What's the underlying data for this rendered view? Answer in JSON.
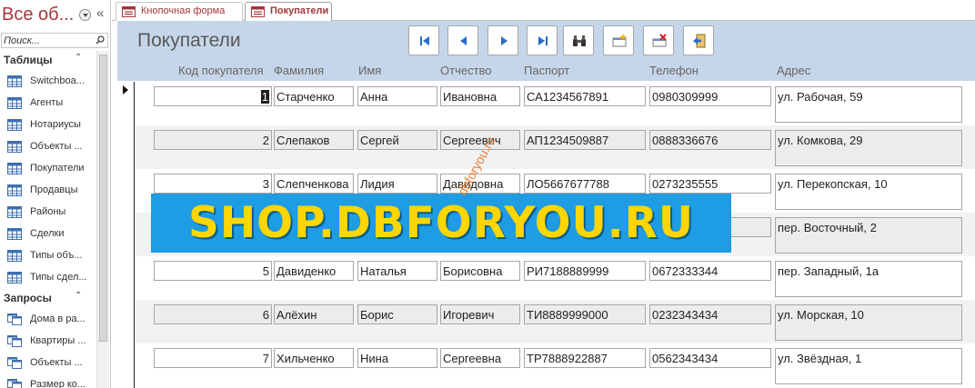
{
  "nav": {
    "title": "Все об...",
    "search_placeholder": "Поиск...",
    "groups": [
      {
        "label": "Таблицы",
        "items": [
          "Switchboa...",
          "Агенты",
          "Нотариусы",
          "Объекты ...",
          "Покупатели",
          "Продавцы",
          "Районы",
          "Сделки",
          "Типы объ...",
          "Типы сдел..."
        ]
      },
      {
        "label": "Запросы",
        "items": [
          "Дома в ра...",
          "Квартиры ...",
          "Объекты ...",
          "Размер ко..."
        ]
      }
    ]
  },
  "tabs": [
    {
      "label": "Кнопочная форма",
      "active": false
    },
    {
      "label": "Покупатели",
      "active": true
    }
  ],
  "form": {
    "title": "Покупатели",
    "buttons": [
      "first-record",
      "previous-record",
      "next-record",
      "last-record",
      "find",
      "new-record",
      "delete-record",
      "close-form"
    ],
    "columns": [
      "Код покупателя",
      "Фамилия",
      "Имя",
      "Отчество",
      "Паспорт",
      "Телефон",
      "Адрес"
    ]
  },
  "records": [
    {
      "id": "1",
      "last": "Старченко",
      "first": "Анна",
      "middle": "Ивановна",
      "passport": "СА1234567891",
      "phone": "0980309999",
      "address": "ул. Рабочая, 59"
    },
    {
      "id": "2",
      "last": "Слепаков",
      "first": "Сергей",
      "middle": "Сергеевич",
      "passport": "АП1234509887",
      "phone": "0888336676",
      "address": "ул. Комкова, 29"
    },
    {
      "id": "3",
      "last": "Слепченкова",
      "first": "Лидия",
      "middle": "Давидовна",
      "passport": "ЛО5667677788",
      "phone": "0273235555",
      "address": "ул. Перекопская, 10"
    },
    {
      "id": "",
      "last": "",
      "first": "",
      "middle": "",
      "passport": "",
      "phone": "",
      "address": "пер. Восточный, 2"
    },
    {
      "id": "5",
      "last": "Давиденко",
      "first": "Наталья",
      "middle": "Борисовна",
      "passport": "РИ7188889999",
      "phone": "0672333344",
      "address": "пер. Западный, 1а"
    },
    {
      "id": "6",
      "last": "Алёхин",
      "first": "Борис",
      "middle": "Игоревич",
      "passport": "ТИ8889999000",
      "phone": "0232343434",
      "address": "ул. Морская, 10"
    },
    {
      "id": "7",
      "last": "Хильченко",
      "first": "Нина",
      "middle": "Сергеевна",
      "passport": "ТР7888922887",
      "phone": "0562343434",
      "address": "ул. Звёздная, 1"
    }
  ],
  "watermark": {
    "banner": "SHOP.DBFORYOU.RU",
    "diagonal": "dbforyou.ru"
  }
}
